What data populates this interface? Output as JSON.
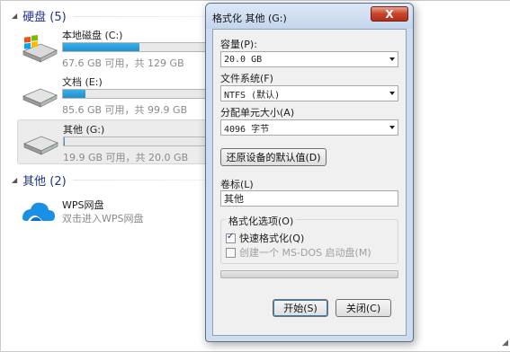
{
  "explorer": {
    "hard_disks_group": "硬盘 (5)",
    "other_group": "其他 (2)",
    "drives": [
      {
        "name": "本地磁盘 (C:)",
        "info": "67.6 GB 可用，共 129 GB",
        "used_fraction": 0.476,
        "icon": "windows-drive-icon"
      },
      {
        "name": "文档 (E:)",
        "info": "85.6 GB 可用，共 99.9 GB",
        "used_fraction": 0.143,
        "icon": "hard-drive-icon"
      },
      {
        "name": "其他 (G:)",
        "info": "19.9 GB 可用，共 20.0 GB",
        "used_fraction": 0.005,
        "icon": "hard-drive-icon"
      }
    ],
    "cloud": {
      "name": "WPS网盘",
      "desc": "双击进入WPS网盘",
      "icon": "wps-cloud-icon"
    },
    "bar_color": "#26a0da"
  },
  "dialog": {
    "title": "格式化 其他 (G:)",
    "close_label": "X",
    "capacity_label": "容量(P):",
    "capacity_value": "20.0 GB",
    "filesystem_label": "文件系统(F)",
    "filesystem_value": "NTFS (默认)",
    "alloc_label": "分配单元大小(A)",
    "alloc_value": "4096 字节",
    "restore_label": "还原设备的默认值(D)",
    "volume_label": "卷标(L)",
    "volume_value": "其他",
    "options_label": "格式化选项(O)",
    "quick_format_label": "快速格式化(Q)",
    "quick_format_checked": true,
    "msdos_label": "创建一个 MS-DOS 启动盘(M)",
    "msdos_checked": false,
    "start_label": "开始(S)",
    "close_button_label": "关闭(C)"
  }
}
